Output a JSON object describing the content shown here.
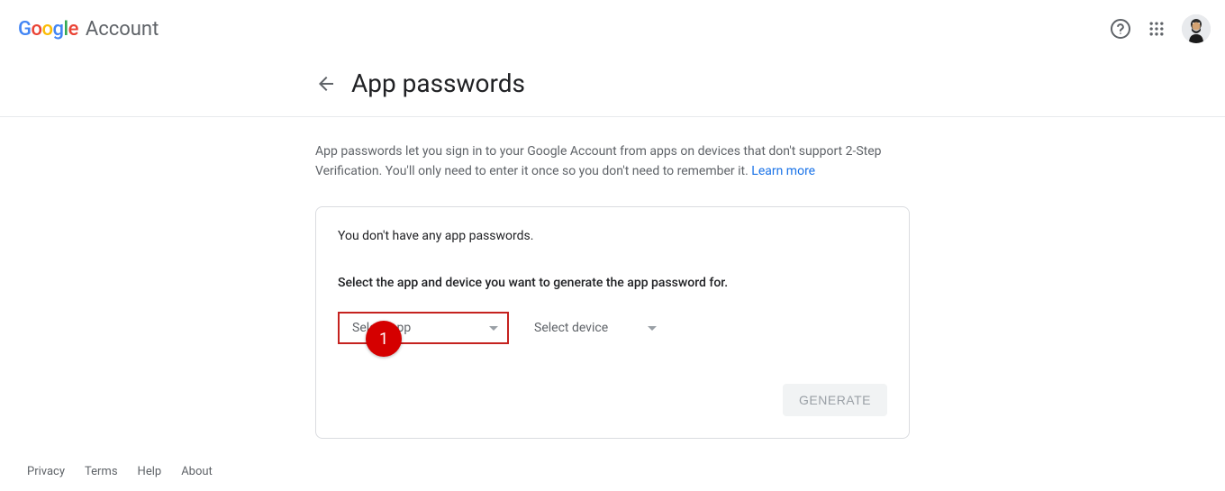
{
  "header": {
    "app_label": "Account"
  },
  "page": {
    "title": "App passwords",
    "description": "App passwords let you sign in to your Google Account from apps on devices that don't support 2-Step Verification. You'll only need to enter it once so you don't need to remember it. ",
    "learn_more": "Learn more"
  },
  "card": {
    "no_passwords": "You don't have any app passwords.",
    "select_prompt": "Select the app and device you want to generate the app password for.",
    "select_app_label": "Select app",
    "select_device_label": "Select device",
    "generate_label": "GENERATE"
  },
  "callout": {
    "number": "1"
  },
  "footer": {
    "privacy": "Privacy",
    "terms": "Terms",
    "help": "Help",
    "about": "About"
  }
}
